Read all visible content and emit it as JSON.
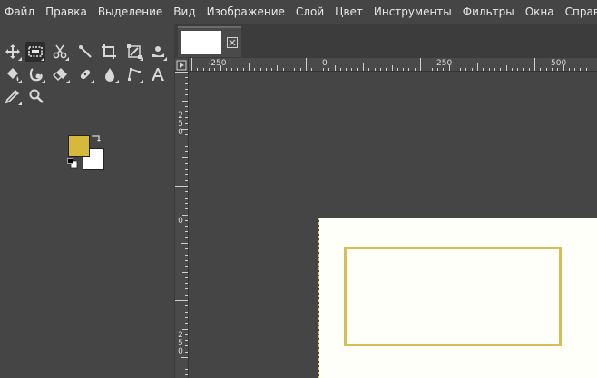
{
  "menubar": {
    "items": [
      "Файл",
      "Правка",
      "Выделение",
      "Вид",
      "Изображение",
      "Слой",
      "Цвет",
      "Инструменты",
      "Фильтры",
      "Окна",
      "Справка"
    ]
  },
  "toolbox": {
    "tools": [
      "move-tool-icon",
      "rect-select-tool-icon",
      "scissors-select-tool-icon",
      "fuzzy-select-tool-icon",
      "crop-tool-icon",
      "unified-transform-tool-icon",
      "warp-transform-tool-icon",
      "bucket-fill-tool-icon",
      "smudge-lasso-tool-icon",
      "eraser-tool-icon",
      "heal-tool-icon",
      "blur-tool-icon",
      "paths-tool-icon",
      "text-tool-icon",
      "color-picker-tool-icon",
      "zoom-tool-icon"
    ],
    "foreground_color": "#d6b83a",
    "background_color": "#ffffff"
  },
  "tabs": {
    "close_icon": "close-icon"
  },
  "rulers": {
    "top_labels": [
      "-250",
      "0",
      "250",
      "500"
    ],
    "left_labels": [
      "250",
      "0",
      "250"
    ]
  },
  "canvas": {
    "background": "#fffffa",
    "shape_color": "#d6be55"
  }
}
